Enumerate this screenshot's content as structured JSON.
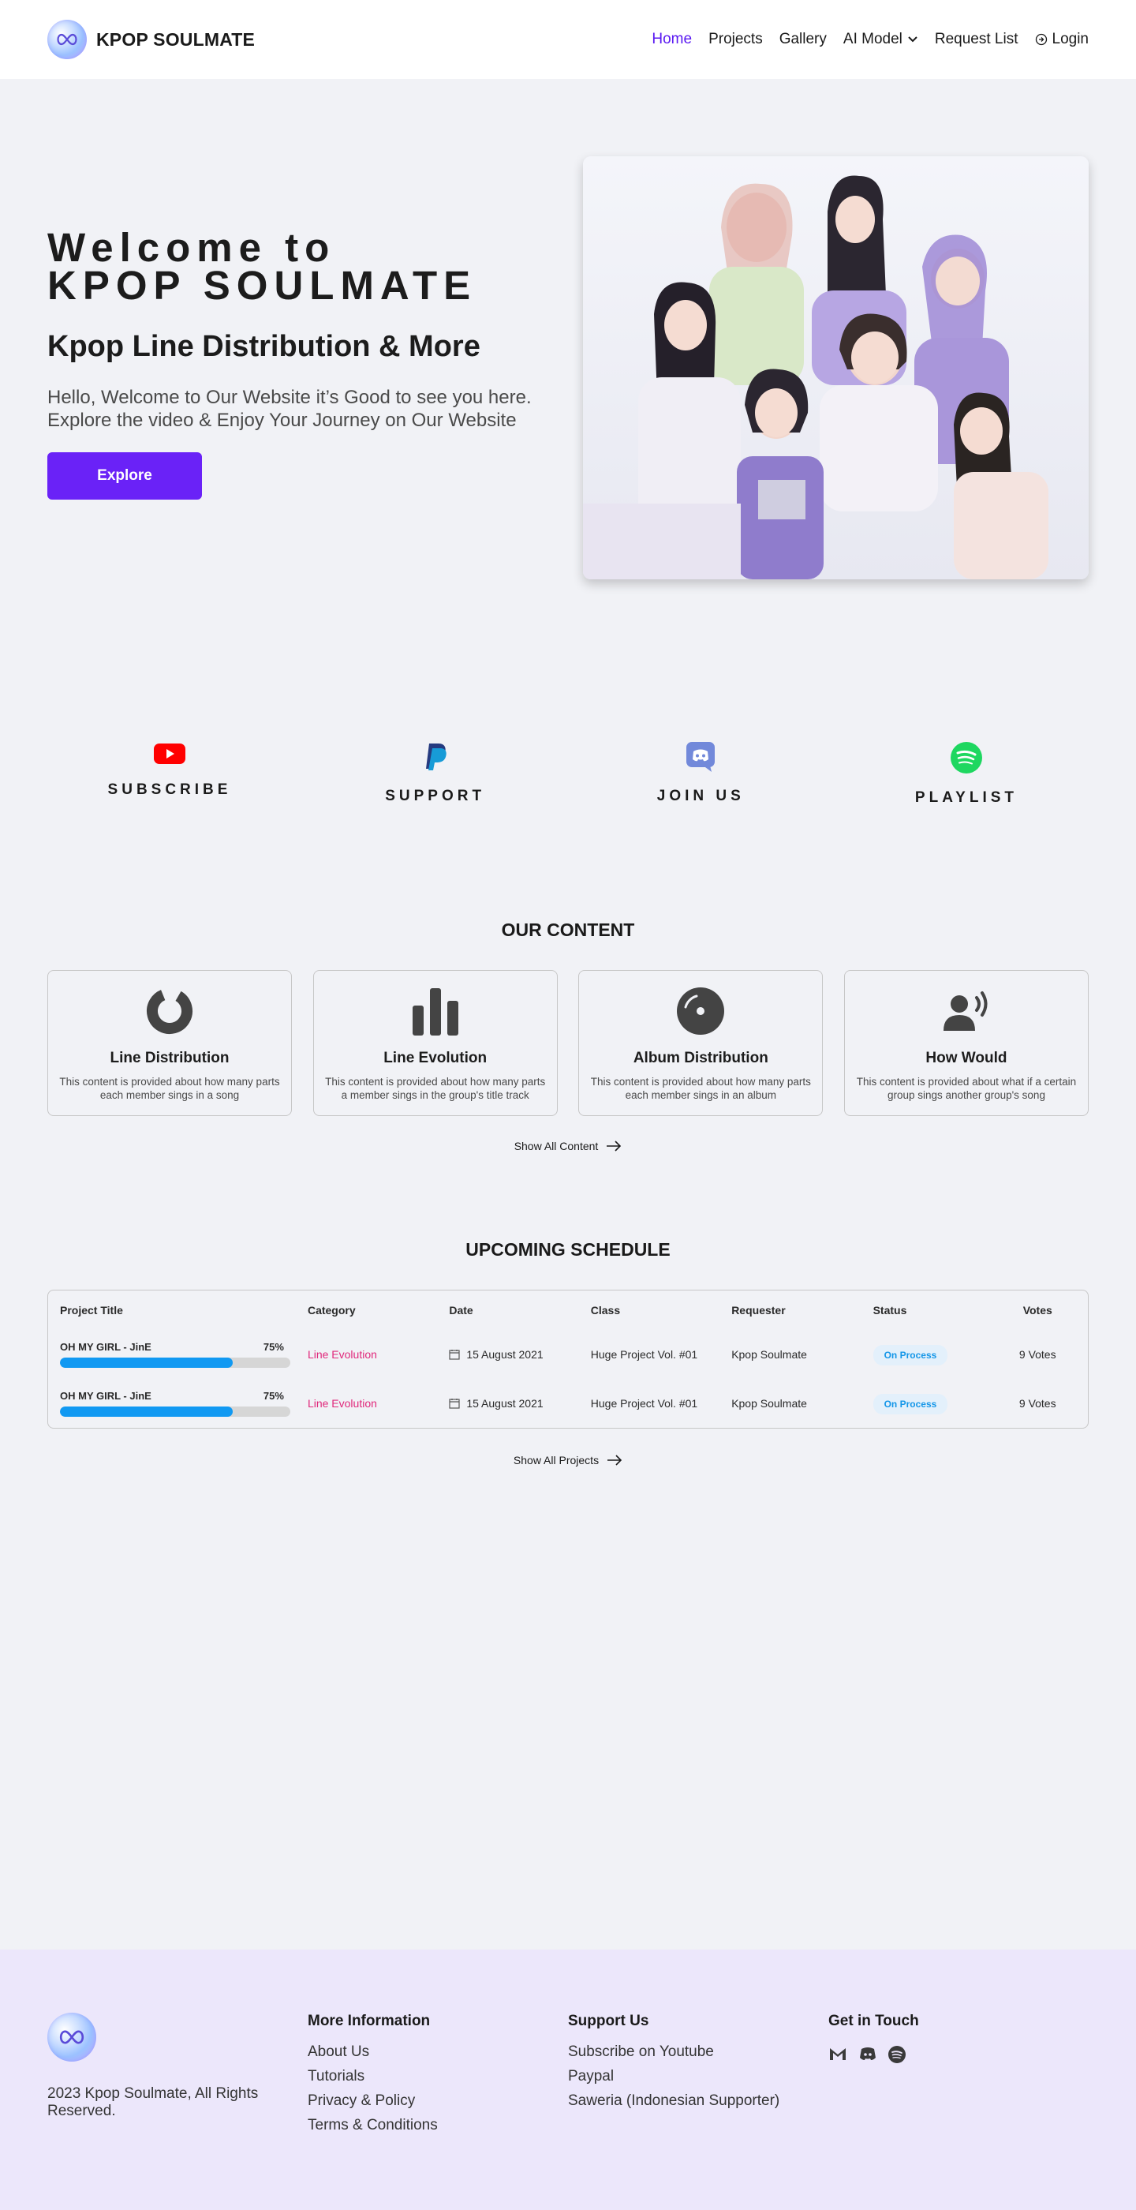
{
  "nav": {
    "brand": "KPOP SOULMATE",
    "items": [
      {
        "label": "Home",
        "active": true
      },
      {
        "label": "Projects",
        "active": false
      },
      {
        "label": "Gallery",
        "active": false
      },
      {
        "label": "AI Model",
        "active": false,
        "dropdown": true
      },
      {
        "label": "Request List",
        "active": false
      }
    ],
    "login": "Login"
  },
  "hero": {
    "title_line1": "Welcome to",
    "title_line2": "KPOP SOULMATE",
    "subtitle": "Kpop Line Distribution & More",
    "description_line1": "Hello, Welcome to Our Website it’s Good to see you here.",
    "description_line2": "Explore the video & Enjoy Your Journey on Our Website",
    "button": "Explore"
  },
  "social": [
    {
      "label": "SUBSCRIBE",
      "icon": "youtube-icon",
      "color": "#ff0000"
    },
    {
      "label": "SUPPORT",
      "icon": "paypal-icon",
      "color": "#009cde"
    },
    {
      "label": "JOIN US",
      "icon": "discord-icon",
      "color": "#7289da"
    },
    {
      "label": "PLAYLIST",
      "icon": "spotify-icon",
      "color": "#1ed760"
    }
  ],
  "content": {
    "title": "OUR CONTENT",
    "cards": [
      {
        "title": "Line Distribution",
        "desc": "This content is provided about how many parts each member sings in a song",
        "icon": "donut-chart-icon"
      },
      {
        "title": "Line Evolution",
        "desc": "This content is provided about how many parts a member sings in the group's title track",
        "icon": "bar-chart-icon"
      },
      {
        "title": "Album Distribution",
        "desc": "This content is provided about how many parts each member sings in an album",
        "icon": "disc-icon"
      },
      {
        "title": "How Would",
        "desc": "This content is provided about what if a certain group sings another group's song",
        "icon": "user-voice-icon"
      }
    ],
    "show_all": "Show All Content"
  },
  "schedule": {
    "title": "UPCOMING SCHEDULE",
    "headers": [
      "Project Title",
      "Category",
      "Date",
      "Class",
      "Requester",
      "Status",
      "Votes"
    ],
    "rows": [
      {
        "title": "OH MY GIRL - JinE",
        "progress_label": "75%",
        "progress": 0.75,
        "category": "Line Evolution",
        "date": "15 August 2021",
        "class": "Huge Project Vol. #01",
        "requester": "Kpop Soulmate",
        "status": "On Process",
        "votes": "9 Votes"
      },
      {
        "title": "OH MY GIRL - JinE",
        "progress_label": "75%",
        "progress": 0.75,
        "category": "Line Evolution",
        "date": "15 August 2021",
        "class": "Huge Project Vol. #01",
        "requester": "Kpop Soulmate",
        "status": "On Process",
        "votes": "9 Votes"
      }
    ],
    "show_all": "Show All Projects"
  },
  "footer": {
    "copyright": "2023 Kpop Soulmate, All Rights Reserved.",
    "more_info": {
      "title": "More Information",
      "links": [
        "About Us",
        "Tutorials",
        "Privacy & Policy",
        "Terms & Conditions"
      ]
    },
    "support": {
      "title": "Support Us",
      "links": [
        "Subscribe on Youtube",
        "Paypal",
        "Saweria (Indonesian Supporter)"
      ]
    },
    "contact": {
      "title": "Get in Touch",
      "icons": [
        "gmail-icon",
        "discord-icon",
        "spotify-icon"
      ]
    }
  },
  "colors": {
    "accent": "#6a22f7",
    "nav_active": "#5a19f2",
    "progress": "#1199f2",
    "category": "#e0287b",
    "footer_bg": "#ece7fb"
  }
}
